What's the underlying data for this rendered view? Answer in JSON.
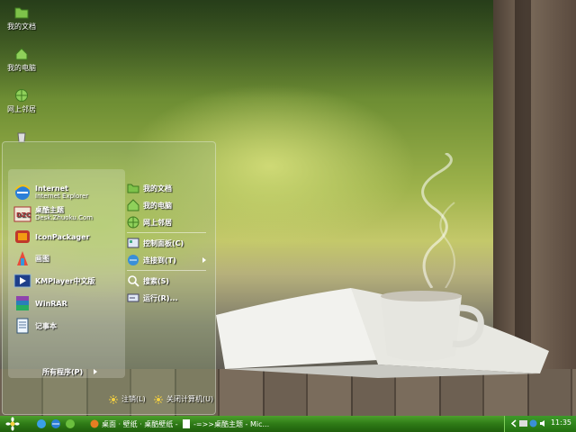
{
  "desktop": {
    "icons": [
      {
        "label": "我的文档",
        "icon": "folder-icon"
      },
      {
        "label": "我的电脑",
        "icon": "computer-icon"
      },
      {
        "label": "网上邻居",
        "icon": "network-icon"
      },
      {
        "label": "",
        "icon": "recycle-bin-icon"
      }
    ]
  },
  "start_menu": {
    "pinned": [
      {
        "title": "Internet",
        "subtitle": "Internet Explorer",
        "icon": "internet-explorer-icon"
      },
      {
        "title": "桌酷主题",
        "subtitle": "Desk.Zhuoku.Com",
        "icon": "theme-icon"
      },
      {
        "title": "IconPackager",
        "subtitle": "",
        "icon": "iconpackager-icon"
      },
      {
        "title": "画图",
        "subtitle": "",
        "icon": "paint-icon"
      },
      {
        "title": "KMPlayer中文版",
        "subtitle": "",
        "icon": "kmplayer-icon"
      },
      {
        "title": "WinRAR",
        "subtitle": "",
        "icon": "winrar-icon"
      },
      {
        "title": "记事本",
        "subtitle": "",
        "icon": "notepad-icon"
      }
    ],
    "all_programs": "所有程序(P)",
    "right": [
      {
        "label": "我的文档",
        "icon": "folder-icon"
      },
      {
        "label": "我的电脑",
        "icon": "computer-icon"
      },
      {
        "label": "网上邻居",
        "icon": "network-icon"
      },
      {
        "label": "控制面板(C)",
        "icon": "control-panel-icon"
      },
      {
        "label": "连接到(T)",
        "icon": "connect-icon"
      },
      {
        "label": "搜索(S)",
        "icon": "search-icon"
      },
      {
        "label": "运行(R)...",
        "icon": "run-icon"
      }
    ],
    "logoff": "注销(L)",
    "shutdown": "关闭计算机(U)"
  },
  "taskbar": {
    "tasks": [
      {
        "label": "桌面 · 壁纸 · 桌酷壁纸 - Mic...",
        "icon": "browser-icon"
      },
      {
        "label": "-=>>桌酷主题 - Mic...",
        "icon": "document-icon"
      }
    ],
    "clock": "11:35"
  },
  "colors": {
    "taskbar": "#2e7a16",
    "accent": "#4da12d"
  }
}
